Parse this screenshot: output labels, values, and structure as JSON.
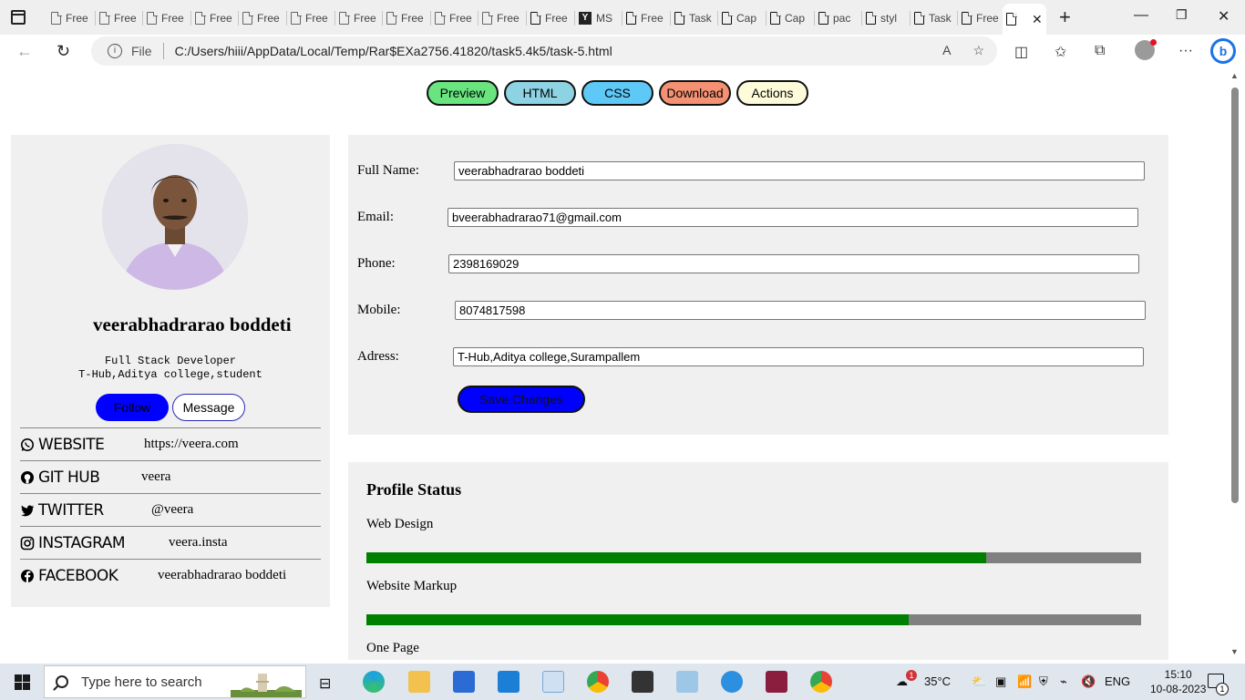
{
  "browser": {
    "tabs": [
      {
        "label": "Free"
      },
      {
        "label": "Free"
      },
      {
        "label": "Free"
      },
      {
        "label": "Free"
      },
      {
        "label": "Free"
      },
      {
        "label": "Free"
      },
      {
        "label": "Free"
      },
      {
        "label": "Free"
      },
      {
        "label": "Free"
      },
      {
        "label": "Free"
      },
      {
        "label": "Free"
      },
      {
        "label": "MS"
      },
      {
        "label": "Free"
      },
      {
        "label": "Task"
      },
      {
        "label": "Cap"
      },
      {
        "label": "Cap"
      },
      {
        "label": "pac"
      },
      {
        "label": "styl"
      },
      {
        "label": "Task"
      },
      {
        "label": "Free"
      }
    ],
    "address": {
      "scheme_label": "File",
      "url": "C:/Users/hiii/AppData/Local/Temp/Rar$EXa2756.41820/task5.4k5/task-5.html"
    }
  },
  "page": {
    "nav": {
      "preview": "Preview",
      "html": "HTML",
      "css": "CSS",
      "download": "Download",
      "actions": "Actions"
    },
    "profile": {
      "name": "veerabhadrarao boddeti",
      "role": "Full Stack Developer",
      "org": "T-Hub,Aditya college,student",
      "follow": "Follow",
      "message": "Message",
      "socials": [
        {
          "label": "WEBSITE",
          "value": "https://veera.com",
          "icon": "whatsapp-icon"
        },
        {
          "label": "GIT HUB",
          "value": "veera",
          "icon": "github-icon"
        },
        {
          "label": "TWITTER",
          "value": "@veera",
          "icon": "twitter-icon"
        },
        {
          "label": "INSTAGRAM",
          "value": "veera.insta",
          "icon": "instagram-icon"
        },
        {
          "label": "FACEBOOK",
          "value": "veerabhadrarao boddeti",
          "icon": "facebook-icon"
        }
      ]
    },
    "form": {
      "fullname_label": "Full Name:",
      "fullname_value": "veerabhadrarao boddeti",
      "email_label": "Email:",
      "email_value": "bveerabhadrarao71@gmail.com",
      "phone_label": "Phone:",
      "phone_value": "2398169029",
      "mobile_label": "Mobile:",
      "mobile_value": "8074817598",
      "address_label": "Adress:",
      "address_value": "T-Hub,Aditya college,Surampallem",
      "save": "Save Changes"
    },
    "status": {
      "title": "Profile Status",
      "items": [
        {
          "label": "Web Design",
          "percent": 80
        },
        {
          "label": "Website Markup",
          "percent": 70
        },
        {
          "label": "One Page"
        }
      ]
    }
  },
  "taskbar": {
    "search_placeholder": "Type here to search",
    "temperature": "35°C",
    "language": "ENG",
    "time": "15:10",
    "date": "10-08-2023",
    "weather_badge": "1",
    "notification_count": "1"
  },
  "colors": {
    "preview": "#69e47f",
    "html": "#8ed3e3",
    "css": "#5ec8f6",
    "download": "#f59173",
    "actions": "#fdfbd9",
    "progress_fill": "#008000",
    "progress_track": "#808080",
    "primary_button": "#0000ff"
  }
}
